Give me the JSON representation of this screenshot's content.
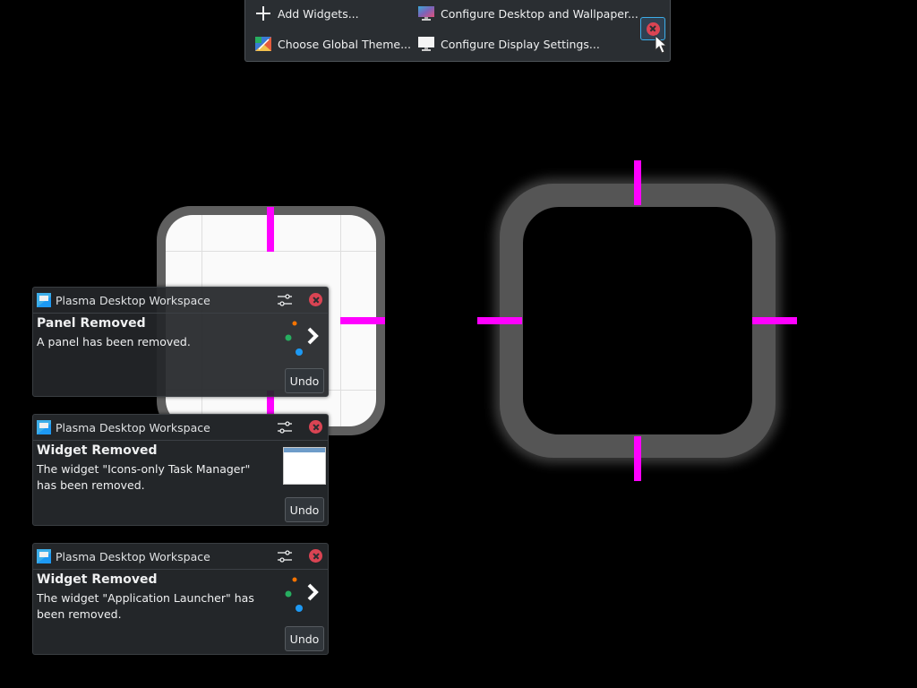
{
  "toolbar": {
    "add_widgets": "Add Widgets...",
    "configure_desktop": "Configure Desktop and Wallpaper...",
    "choose_theme": "Choose Global Theme...",
    "configure_display": "Configure Display Settings..."
  },
  "notifications": [
    {
      "app_name": "Plasma Desktop Workspace",
      "title": "Panel Removed",
      "body": "A panel has been removed.",
      "action": "Undo"
    },
    {
      "app_name": "Plasma Desktop Workspace",
      "title": "Widget Removed",
      "body": "The widget \"Icons-only Task Manager\" has been removed.",
      "action": "Undo"
    },
    {
      "app_name": "Plasma Desktop Workspace",
      "title": "Widget Removed",
      "body": "The widget \"Application Launcher\" has been removed.",
      "action": "Undo"
    }
  ],
  "colors": {
    "accent": "#3daee9",
    "close_red": "#da4453",
    "marker_magenta": "#ff00ff",
    "panel_bg": "#2a2e32"
  }
}
